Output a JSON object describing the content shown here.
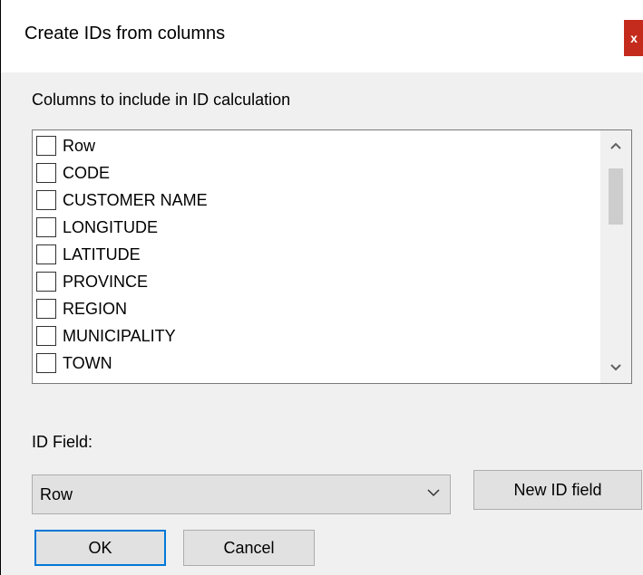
{
  "window": {
    "title": "Create IDs from columns",
    "close_label": "x"
  },
  "columns_section": {
    "label": "Columns to include in ID calculation",
    "items": [
      {
        "label": "Row",
        "checked": false
      },
      {
        "label": "CODE",
        "checked": false
      },
      {
        "label": "CUSTOMER NAME",
        "checked": false
      },
      {
        "label": "LONGITUDE",
        "checked": false
      },
      {
        "label": "LATITUDE",
        "checked": false
      },
      {
        "label": "PROVINCE",
        "checked": false
      },
      {
        "label": "REGION",
        "checked": false
      },
      {
        "label": "MUNICIPALITY",
        "checked": false
      },
      {
        "label": "TOWN",
        "checked": false
      }
    ],
    "scroll_up_icon": "chevron-up-icon",
    "scroll_down_icon": "chevron-down-icon"
  },
  "id_field": {
    "label": "ID Field:",
    "selected": "Row",
    "dropdown_icon": "chevron-down-icon"
  },
  "buttons": {
    "new_id_field": "New ID field",
    "ok": "OK",
    "cancel": "Cancel"
  },
  "colors": {
    "close_button": "#c42b1c",
    "focus_border": "#0078d7"
  }
}
